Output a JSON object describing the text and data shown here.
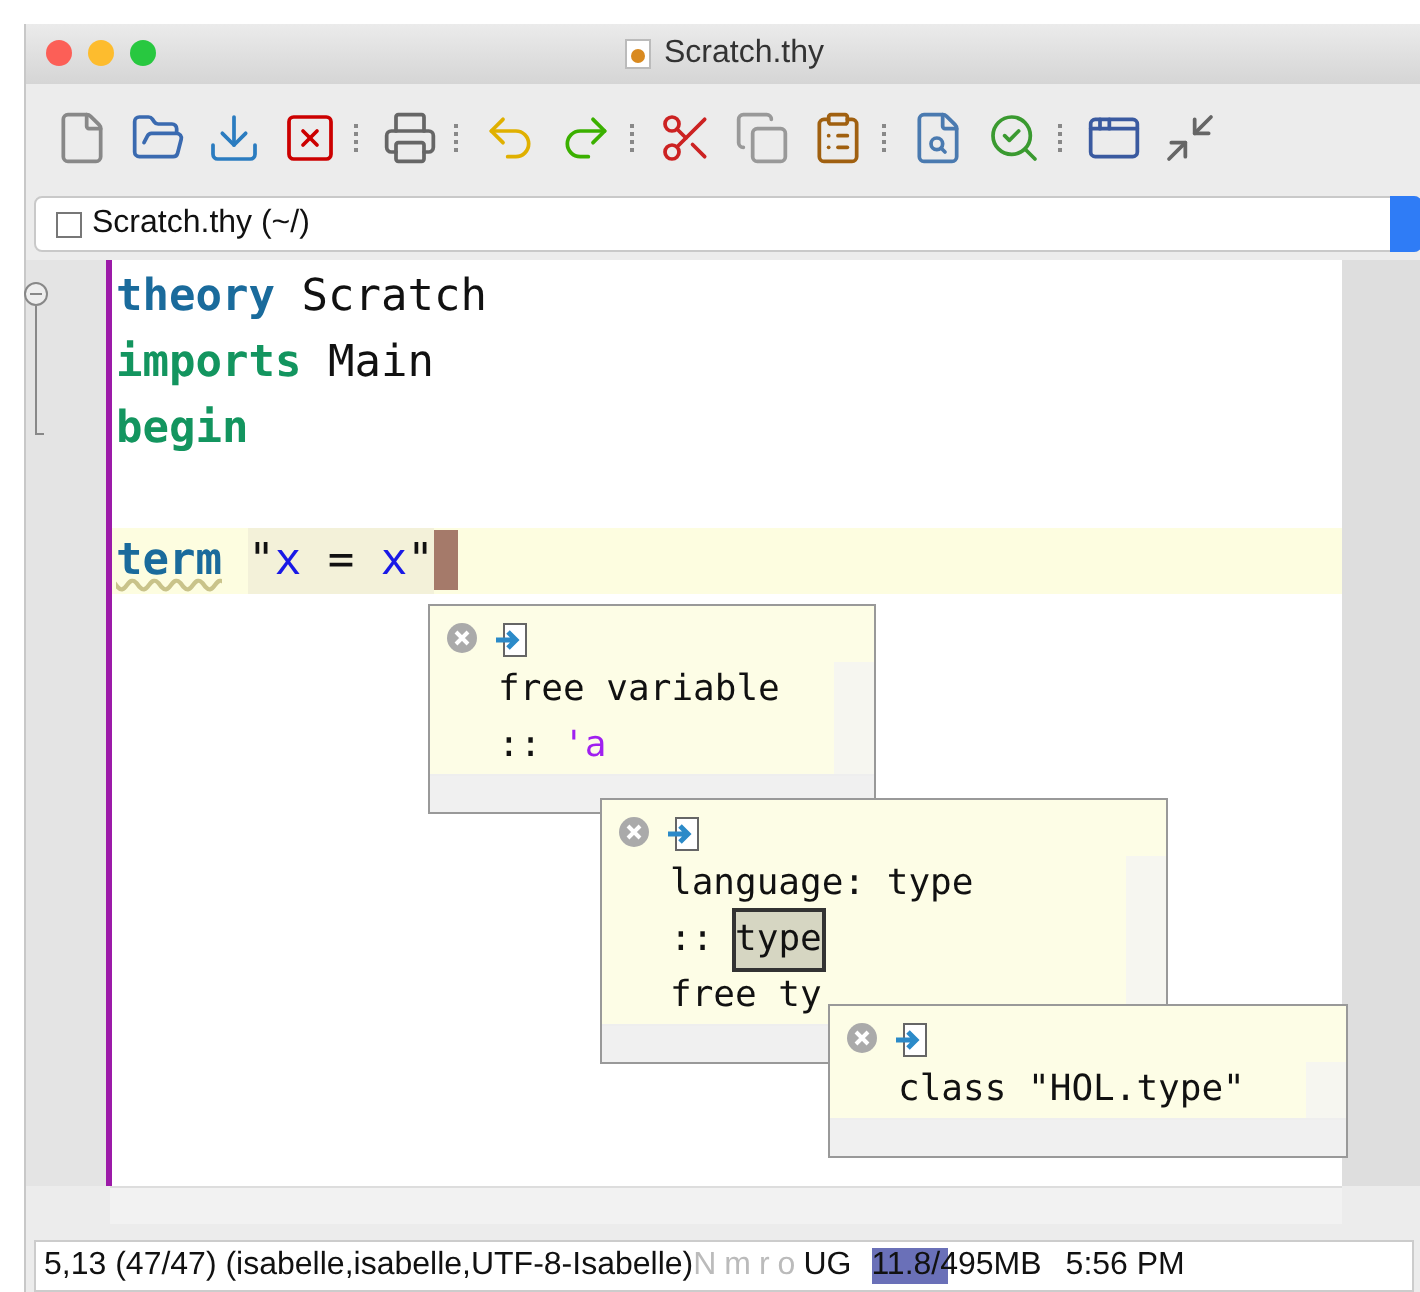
{
  "window": {
    "title": "Scratch.thy"
  },
  "buffer_selector": {
    "value": "Scratch.thy (~/)"
  },
  "editor": {
    "lines": [
      {
        "current": false,
        "tokens": [
          {
            "text": "theory",
            "kind": "keyword"
          },
          {
            "text": " Scratch",
            "kind": "plain"
          }
        ]
      },
      {
        "current": false,
        "tokens": [
          {
            "text": "imports",
            "kind": "keyword2"
          },
          {
            "text": " Main",
            "kind": "plain"
          }
        ]
      },
      {
        "current": false,
        "tokens": [
          {
            "text": "begin",
            "kind": "keyword2"
          }
        ]
      },
      {
        "current": false
      },
      {
        "current": true,
        "tokens": [
          {
            "text": "term",
            "kind": "keyword-warn"
          },
          {
            "text": "\"",
            "kind": "string"
          },
          {
            "text": "x",
            "kind": "var"
          },
          {
            "text": " = ",
            "kind": "string"
          },
          {
            "text": "x",
            "kind": "var"
          },
          {
            "text": "\"",
            "kind": "string"
          }
        ]
      }
    ],
    "tooltips": [
      {
        "lines": [
          [
            {
              "text": "free variable",
              "kind": "plain"
            }
          ],
          [
            {
              "text": ":: ",
              "kind": "plain"
            },
            {
              "text": "'a",
              "kind": "tfree"
            }
          ]
        ]
      },
      {
        "lines": [
          [
            {
              "text": "language: type",
              "kind": "plain"
            }
          ],
          [
            {
              "text": ":: ",
              "kind": "plain"
            },
            {
              "text": "type",
              "kind": "hover"
            }
          ],
          [
            {
              "text": "free ty",
              "kind": "plain"
            }
          ]
        ]
      },
      {
        "lines": [
          [
            {
              "text": "class \"HOL.type\"",
              "kind": "plain"
            }
          ]
        ]
      }
    ]
  },
  "status_bar": {
    "position": "5,13 (47/47) (isabelle,isabelle,UTF-8-Isabelle)",
    "flags": "Nmro",
    "mode": "UG",
    "memory": {
      "text": "11.8/495MB",
      "level": 0.45
    },
    "time": "5:56 PM"
  }
}
